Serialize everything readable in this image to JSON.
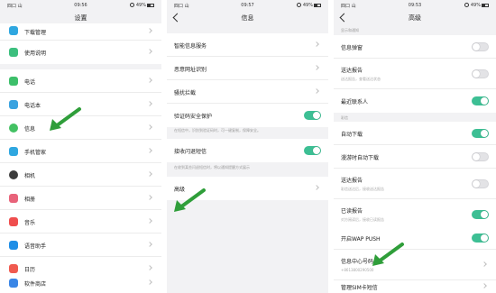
{
  "status": {
    "p1": {
      "carrier": "四口 山",
      "time": "09:56",
      "battery": "49%"
    },
    "p2": {
      "carrier": "四口 山",
      "time": "09:57",
      "battery": "49%"
    },
    "p3": {
      "carrier": "四口 山",
      "time": "09:53",
      "battery": "49%"
    }
  },
  "settings": {
    "title": "设置",
    "items": [
      {
        "label": "下载管理",
        "color": "#2fa7e0"
      },
      {
        "label": "使用说明",
        "color": "#3cbf7e"
      },
      {
        "label": "电话",
        "color": "#3dbf6a"
      },
      {
        "label": "电话本",
        "color": "#3aa3e0"
      },
      {
        "label": "信息",
        "color": "#43c163"
      },
      {
        "label": "手机管家",
        "color": "#2fa7e0"
      },
      {
        "label": "相机",
        "color": "#3b3b3b"
      },
      {
        "label": "相册",
        "color": "#e8637a"
      },
      {
        "label": "音乐",
        "color": "#ef4e4e"
      },
      {
        "label": "语音助手",
        "color": "#1f8ee6"
      },
      {
        "label": "日历",
        "color": "#f05a4f"
      },
      {
        "label": "软件商店",
        "color": "#3a86e6"
      }
    ]
  },
  "messages": {
    "title": "信息",
    "items": [
      {
        "label": "智能信息服务"
      },
      {
        "label": "恶意网址识别"
      },
      {
        "label": "骚扰拦截"
      },
      {
        "label": "验证码安全保护",
        "toggle": true
      }
    ],
    "note1": "在短信中，识别到验证码时，可一键复制，保障安全。",
    "receive": {
      "label": "接收闪退短信",
      "toggle": true
    },
    "note2": "在收到某些闪退短信时，将以通知提醒方式展示",
    "advanced": "高级"
  },
  "advanced": {
    "title": "高级",
    "section1": "显示和通知",
    "items1": [
      {
        "label": "信息弹窗",
        "toggle": false
      },
      {
        "label": "送达报告",
        "sub": "送达报告，查看送达状态",
        "toggle": false
      },
      {
        "label": "最近联系人",
        "toggle": true
      }
    ],
    "section2": "彩信",
    "items2": [
      {
        "label": "自动下载",
        "toggle": true
      },
      {
        "label": "漫游时自动下载",
        "toggle": false
      },
      {
        "label": "送达报告",
        "sub": "彩信送达后，接收送达报告",
        "toggle": false
      },
      {
        "label": "已读报告",
        "sub": "对方阅读后，接收已读报告",
        "toggle": true
      }
    ],
    "section3": "其他",
    "items3": [
      {
        "label": "开启WAP PUSH",
        "toggle": true
      },
      {
        "label": "信息中心号码",
        "sub": "+8613800290500"
      },
      {
        "label": "管理SIM卡短信"
      }
    ]
  }
}
